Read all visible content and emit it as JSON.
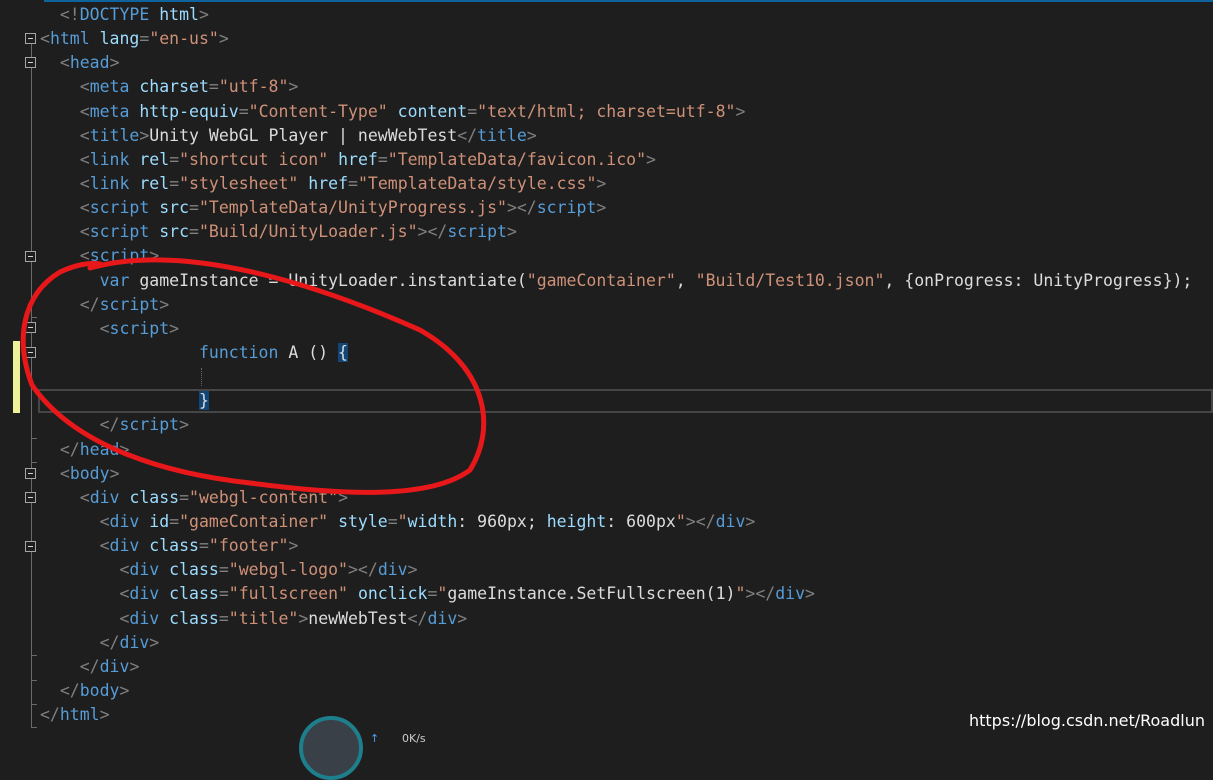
{
  "editor": {
    "lines": [
      [
        [
          "d",
          "  <!"
        ],
        [
          "t",
          "DOCTYPE"
        ],
        [
          "p",
          " "
        ],
        [
          "a",
          "html"
        ],
        [
          "d",
          ">"
        ]
      ],
      [
        [
          "d",
          "<"
        ],
        [
          "t",
          "html"
        ],
        [
          "p",
          " "
        ],
        [
          "a",
          "lang"
        ],
        [
          "d",
          "="
        ],
        [
          "v",
          "\"en-us\""
        ],
        [
          "d",
          ">"
        ]
      ],
      [
        [
          "p",
          "  "
        ],
        [
          "d",
          "<"
        ],
        [
          "t",
          "head"
        ],
        [
          "d",
          ">"
        ]
      ],
      [
        [
          "p",
          "    "
        ],
        [
          "d",
          "<"
        ],
        [
          "t",
          "meta"
        ],
        [
          "p",
          " "
        ],
        [
          "a",
          "charset"
        ],
        [
          "d",
          "="
        ],
        [
          "v",
          "\"utf-8\""
        ],
        [
          "d",
          ">"
        ]
      ],
      [
        [
          "p",
          "    "
        ],
        [
          "d",
          "<"
        ],
        [
          "t",
          "meta"
        ],
        [
          "p",
          " "
        ],
        [
          "a",
          "http-equiv"
        ],
        [
          "d",
          "="
        ],
        [
          "v",
          "\"Content-Type\""
        ],
        [
          "p",
          " "
        ],
        [
          "a",
          "content"
        ],
        [
          "d",
          "="
        ],
        [
          "v",
          "\"text/html; charset=utf-8\""
        ],
        [
          "d",
          ">"
        ]
      ],
      [
        [
          "p",
          "    "
        ],
        [
          "d",
          "<"
        ],
        [
          "t",
          "title"
        ],
        [
          "d",
          ">"
        ],
        [
          "p",
          "Unity WebGL Player | newWebTest"
        ],
        [
          "d",
          "</"
        ],
        [
          "t",
          "title"
        ],
        [
          "d",
          ">"
        ]
      ],
      [
        [
          "p",
          "    "
        ],
        [
          "d",
          "<"
        ],
        [
          "t",
          "link"
        ],
        [
          "p",
          " "
        ],
        [
          "a",
          "rel"
        ],
        [
          "d",
          "="
        ],
        [
          "v",
          "\"shortcut icon\""
        ],
        [
          "p",
          " "
        ],
        [
          "a",
          "href"
        ],
        [
          "d",
          "="
        ],
        [
          "v",
          "\"TemplateData/favicon.ico\""
        ],
        [
          "d",
          ">"
        ]
      ],
      [
        [
          "p",
          "    "
        ],
        [
          "d",
          "<"
        ],
        [
          "t",
          "link"
        ],
        [
          "p",
          " "
        ],
        [
          "a",
          "rel"
        ],
        [
          "d",
          "="
        ],
        [
          "v",
          "\"stylesheet\""
        ],
        [
          "p",
          " "
        ],
        [
          "a",
          "href"
        ],
        [
          "d",
          "="
        ],
        [
          "v",
          "\"TemplateData/style.css\""
        ],
        [
          "d",
          ">"
        ]
      ],
      [
        [
          "p",
          "    "
        ],
        [
          "d",
          "<"
        ],
        [
          "t",
          "script"
        ],
        [
          "p",
          " "
        ],
        [
          "a",
          "src"
        ],
        [
          "d",
          "="
        ],
        [
          "v",
          "\"TemplateData/UnityProgress.js\""
        ],
        [
          "d",
          "></"
        ],
        [
          "t",
          "script"
        ],
        [
          "d",
          ">"
        ]
      ],
      [
        [
          "p",
          "    "
        ],
        [
          "d",
          "<"
        ],
        [
          "t",
          "script"
        ],
        [
          "p",
          " "
        ],
        [
          "a",
          "src"
        ],
        [
          "d",
          "="
        ],
        [
          "v",
          "\"Build/UnityLoader.js\""
        ],
        [
          "d",
          "></"
        ],
        [
          "t",
          "script"
        ],
        [
          "d",
          ">"
        ]
      ],
      [
        [
          "p",
          "    "
        ],
        [
          "d",
          "<"
        ],
        [
          "t",
          "script"
        ],
        [
          "d",
          ">"
        ]
      ],
      [
        [
          "p",
          "      "
        ],
        [
          "k",
          "var"
        ],
        [
          "p",
          " gameInstance = UnityLoader.instantiate("
        ],
        [
          "v",
          "\"gameContainer\""
        ],
        [
          "p",
          ", "
        ],
        [
          "v",
          "\"Build/Test10.json\""
        ],
        [
          "p",
          ", {onProgress: UnityProgress});"
        ]
      ],
      [
        [
          "p",
          "    "
        ],
        [
          "d",
          "</"
        ],
        [
          "t",
          "script"
        ],
        [
          "d",
          ">"
        ]
      ],
      [
        [
          "p",
          "      "
        ],
        [
          "d",
          "<"
        ],
        [
          "t",
          "script"
        ],
        [
          "d",
          ">"
        ]
      ],
      [
        [
          "p",
          "                "
        ],
        [
          "k",
          "function"
        ],
        [
          "p",
          " A () "
        ],
        [
          "bm",
          "{"
        ]
      ],
      [
        [
          "p",
          ""
        ]
      ],
      [
        [
          "p",
          "                "
        ],
        [
          "bm",
          "}"
        ]
      ],
      [
        [
          "p",
          "      "
        ],
        [
          "d",
          "</"
        ],
        [
          "t",
          "script"
        ],
        [
          "d",
          ">"
        ]
      ],
      [
        [
          "p",
          "  "
        ],
        [
          "d",
          "</"
        ],
        [
          "t",
          "head"
        ],
        [
          "d",
          ">"
        ]
      ],
      [
        [
          "p",
          "  "
        ],
        [
          "d",
          "<"
        ],
        [
          "t",
          "body"
        ],
        [
          "d",
          ">"
        ]
      ],
      [
        [
          "p",
          "    "
        ],
        [
          "d",
          "<"
        ],
        [
          "t",
          "div"
        ],
        [
          "p",
          " "
        ],
        [
          "a",
          "class"
        ],
        [
          "d",
          "="
        ],
        [
          "v",
          "\"webgl-content\""
        ],
        [
          "d",
          ">"
        ]
      ],
      [
        [
          "p",
          "      "
        ],
        [
          "d",
          "<"
        ],
        [
          "t",
          "div"
        ],
        [
          "p",
          " "
        ],
        [
          "a",
          "id"
        ],
        [
          "d",
          "="
        ],
        [
          "v",
          "\"gameContainer\""
        ],
        [
          "p",
          " "
        ],
        [
          "a",
          "style"
        ],
        [
          "d",
          "="
        ],
        [
          "v",
          "\""
        ],
        [
          "a",
          "width"
        ],
        [
          "p",
          ": 960px; "
        ],
        [
          "a",
          "height"
        ],
        [
          "p",
          ": 600px"
        ],
        [
          "v",
          "\""
        ],
        [
          "d",
          "></"
        ],
        [
          "t",
          "div"
        ],
        [
          "d",
          ">"
        ]
      ],
      [
        [
          "p",
          "      "
        ],
        [
          "d",
          "<"
        ],
        [
          "t",
          "div"
        ],
        [
          "p",
          " "
        ],
        [
          "a",
          "class"
        ],
        [
          "d",
          "="
        ],
        [
          "v",
          "\"footer\""
        ],
        [
          "d",
          ">"
        ]
      ],
      [
        [
          "p",
          "        "
        ],
        [
          "d",
          "<"
        ],
        [
          "t",
          "div"
        ],
        [
          "p",
          " "
        ],
        [
          "a",
          "class"
        ],
        [
          "d",
          "="
        ],
        [
          "v",
          "\"webgl-logo\""
        ],
        [
          "d",
          "></"
        ],
        [
          "t",
          "div"
        ],
        [
          "d",
          ">"
        ]
      ],
      [
        [
          "p",
          "        "
        ],
        [
          "d",
          "<"
        ],
        [
          "t",
          "div"
        ],
        [
          "p",
          " "
        ],
        [
          "a",
          "class"
        ],
        [
          "d",
          "="
        ],
        [
          "v",
          "\"fullscreen\""
        ],
        [
          "p",
          " "
        ],
        [
          "a",
          "onclick"
        ],
        [
          "d",
          "="
        ],
        [
          "v",
          "\""
        ],
        [
          "p",
          "gameInstance.SetFullscreen(1)"
        ],
        [
          "v",
          "\""
        ],
        [
          "d",
          "></"
        ],
        [
          "t",
          "div"
        ],
        [
          "d",
          ">"
        ]
      ],
      [
        [
          "p",
          "        "
        ],
        [
          "d",
          "<"
        ],
        [
          "t",
          "div"
        ],
        [
          "p",
          " "
        ],
        [
          "a",
          "class"
        ],
        [
          "d",
          "="
        ],
        [
          "v",
          "\"title\""
        ],
        [
          "d",
          ">"
        ],
        [
          "p",
          "newWebTest"
        ],
        [
          "d",
          "</"
        ],
        [
          "t",
          "div"
        ],
        [
          "d",
          ">"
        ]
      ],
      [
        [
          "p",
          "      "
        ],
        [
          "d",
          "</"
        ],
        [
          "t",
          "div"
        ],
        [
          "d",
          ">"
        ]
      ],
      [
        [
          "p",
          "    "
        ],
        [
          "d",
          "</"
        ],
        [
          "t",
          "div"
        ],
        [
          "d",
          ">"
        ]
      ],
      [
        [
          "p",
          "  "
        ],
        [
          "d",
          "</"
        ],
        [
          "t",
          "body"
        ],
        [
          "d",
          ">"
        ]
      ],
      [
        [
          "d",
          "</"
        ],
        [
          "t",
          "html"
        ],
        [
          "d",
          ">"
        ]
      ]
    ],
    "fold_markers": [
      "collapse-icon",
      "collapse-icon",
      "collapse-icon",
      "collapse-icon",
      "collapse-icon",
      "collapse-icon",
      "collapse-icon"
    ]
  },
  "annotation": {
    "shape": "hand-drawn-circle",
    "color": "#e8181a"
  },
  "watermark": {
    "text": "https://blog.csdn.net/Roadlun"
  },
  "network_widget": {
    "text": "0K/s",
    "arrow": "↑"
  }
}
